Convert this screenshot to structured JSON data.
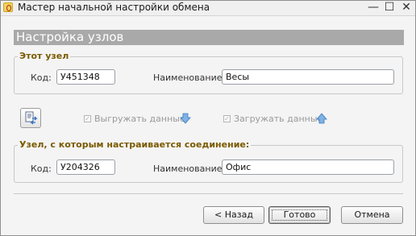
{
  "window": {
    "title": "Мастер начальной настройки обмена",
    "buttons": {
      "minimize": "—",
      "maximize": "☐",
      "close": "✕"
    }
  },
  "banner": {
    "title": "Настройка узлов"
  },
  "this_node": {
    "legend": "Этот узел",
    "code_label": "Код:",
    "code_value": "У451348",
    "name_label": "Наименование:",
    "name_value": "Весы"
  },
  "exchange": {
    "export_label": "Выгружать данные",
    "export_checked": true,
    "import_label": "Загружать данные",
    "import_checked": true,
    "export_icon": "arrow-down-icon",
    "import_icon": "arrow-up-icon",
    "settings_icon": "exchange-settings-icon"
  },
  "peer_node": {
    "legend": "Узел, с которым настраивается соединение:",
    "code_label": "Код:",
    "code_value": "У204326",
    "name_label": "Наименование:",
    "name_value": "Офис"
  },
  "footer": {
    "back_label": "< Назад",
    "done_label": "Готово",
    "cancel_label": "Отмена"
  },
  "colors": {
    "legend": "#7a5a00",
    "banner": "#a9a9a9",
    "arrow": "#5b9bd5"
  }
}
